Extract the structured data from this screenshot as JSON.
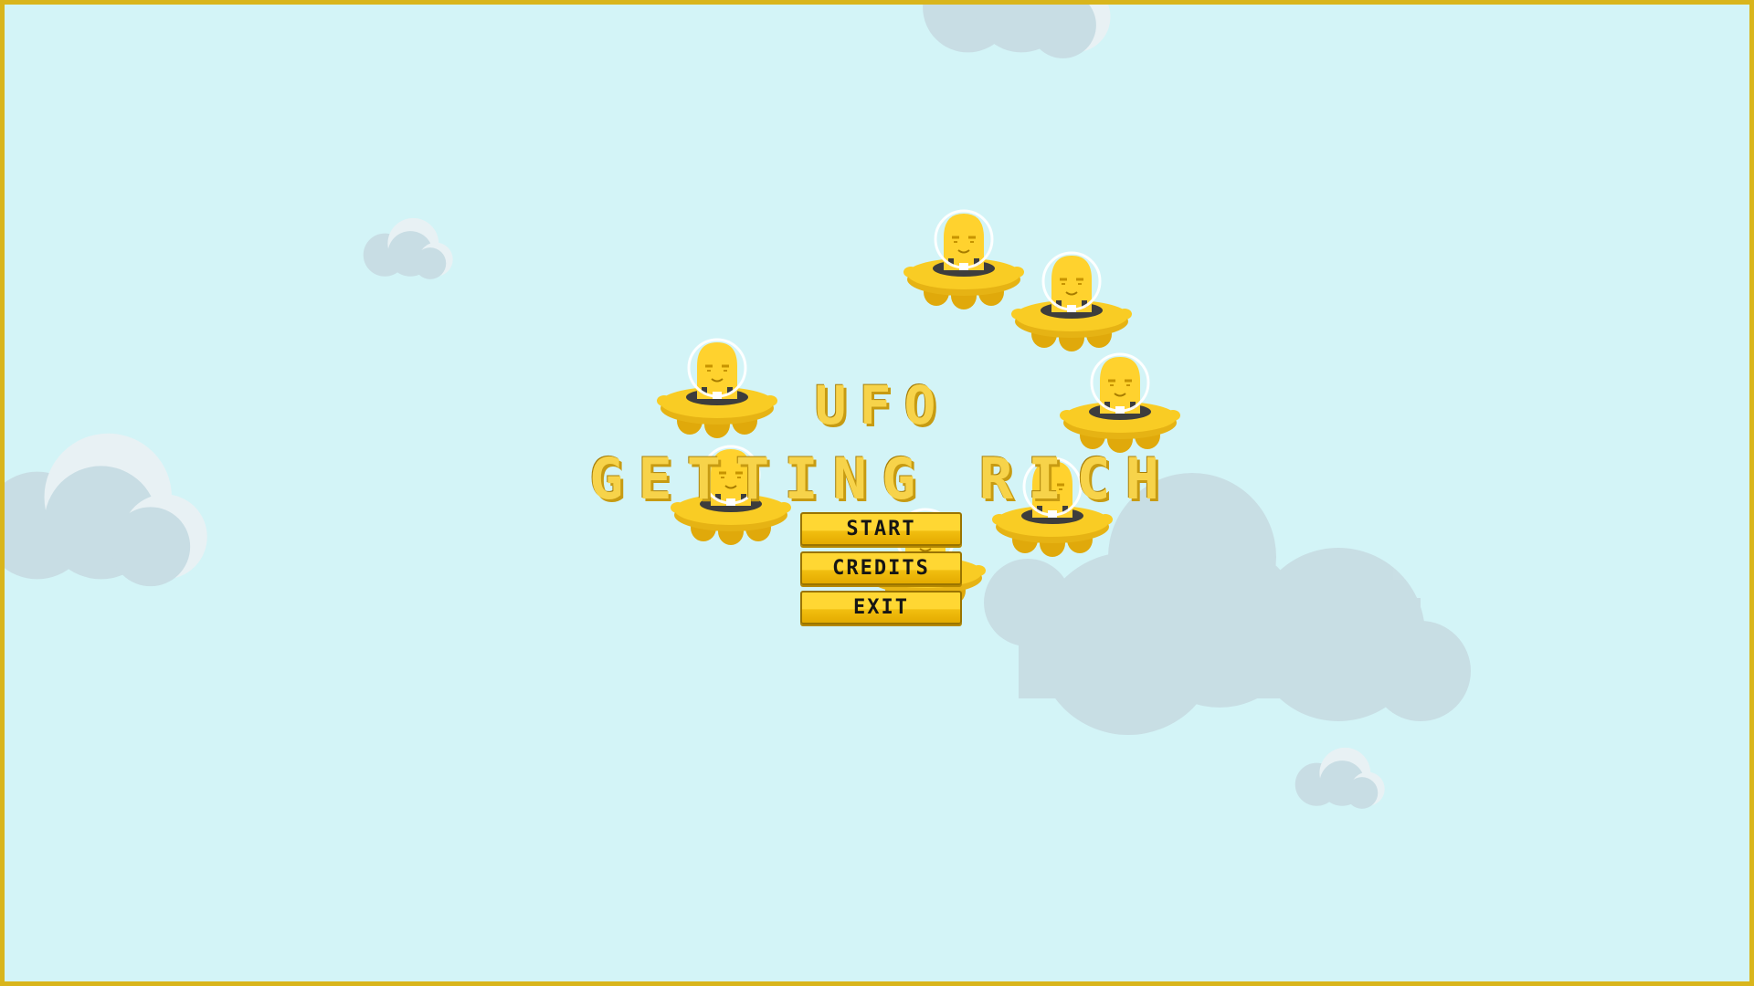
{
  "title": {
    "line1": "UFO",
    "line2": "GETTING RICH"
  },
  "menu": {
    "start_label": "START",
    "credits_label": "CREDITS",
    "exit_label": "EXIT"
  },
  "colors": {
    "sky": "#d3f4f7",
    "frame": "#d9b51c",
    "cloud_shadow": "#c8dde4",
    "cloud_light": "#e8f1f4",
    "ufo_yellow": "#f9cc24",
    "ufo_dark_yellow": "#e0a90b",
    "alien_yellow": "#ffd22e",
    "dome_outline": "#ffffff",
    "cockpit_dark": "#3d3d3d",
    "button_yellow": "#ffd733",
    "button_text": "#151515"
  },
  "sprites": {
    "ufo_count": 8,
    "cloud_count": 5,
    "icons": [
      "ufo-alien-sprite",
      "cloud-sprite"
    ]
  }
}
